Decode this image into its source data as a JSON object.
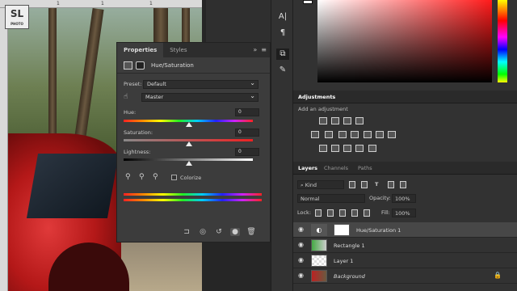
{
  "canvas": {
    "ruler_marks": [
      "1",
      "1",
      "1"
    ],
    "watermark": {
      "main": "SL",
      "sub": "PHOTO"
    }
  },
  "properties": {
    "tabs": [
      "Properties",
      "Styles"
    ],
    "header_icons": [
      "double-chevron-icon",
      "menu-icon"
    ],
    "adjustment_title": "Hue/Saturation",
    "preset_label": "Preset:",
    "preset_value": "Default",
    "channel_value": "Master",
    "hue_label": "Hue:",
    "hue_value": "0",
    "saturation_label": "Saturation:",
    "saturation_value": "0",
    "lightness_label": "Lightness:",
    "lightness_value": "0",
    "colorize_label": "Colorize",
    "colorize_checked": false,
    "bottom_icons": [
      "clip-to-layer-icon",
      "view-previous-icon",
      "reset-icon",
      "visibility-icon",
      "trash-icon"
    ]
  },
  "tools": [
    "text-A-icon",
    "paragraph-icon",
    "3d-icon",
    "brush-panel-icon"
  ],
  "colors": {
    "foreground_swatch": "#ffffff",
    "picker_hue": "#ff1a1a"
  },
  "adjustments": {
    "tab": "Adjustments",
    "label": "Add an adjustment",
    "row1_icons": [
      "brightness-icon",
      "levels-icon",
      "curves-icon",
      "exposure-icon"
    ],
    "row2_icons": [
      "vibrance-icon",
      "hue-saturation-icon",
      "color-balance-icon",
      "black-white-icon",
      "photo-filter-icon",
      "channel-mixer-icon",
      "color-lookup-icon"
    ],
    "row3_icons": [
      "invert-icon",
      "posterize-icon",
      "threshold-icon",
      "selective-color-icon",
      "gradient-map-icon"
    ]
  },
  "layers_panel": {
    "tabs": [
      "Layers",
      "Channels",
      "Paths"
    ],
    "kind_value": "Kind",
    "blend_mode": "Normal",
    "opacity_label": "Opacity:",
    "opacity_value": "100%",
    "lock_label": "Lock:",
    "fill_label": "Fill:",
    "fill_value": "100%",
    "layers": [
      {
        "name": "Hue/Saturation 1",
        "selected": true
      },
      {
        "name": "Rectangle 1",
        "selected": false
      },
      {
        "name": "Layer 1",
        "selected": false
      },
      {
        "name": "Background",
        "selected": false,
        "italic": true,
        "locked": true
      }
    ]
  }
}
